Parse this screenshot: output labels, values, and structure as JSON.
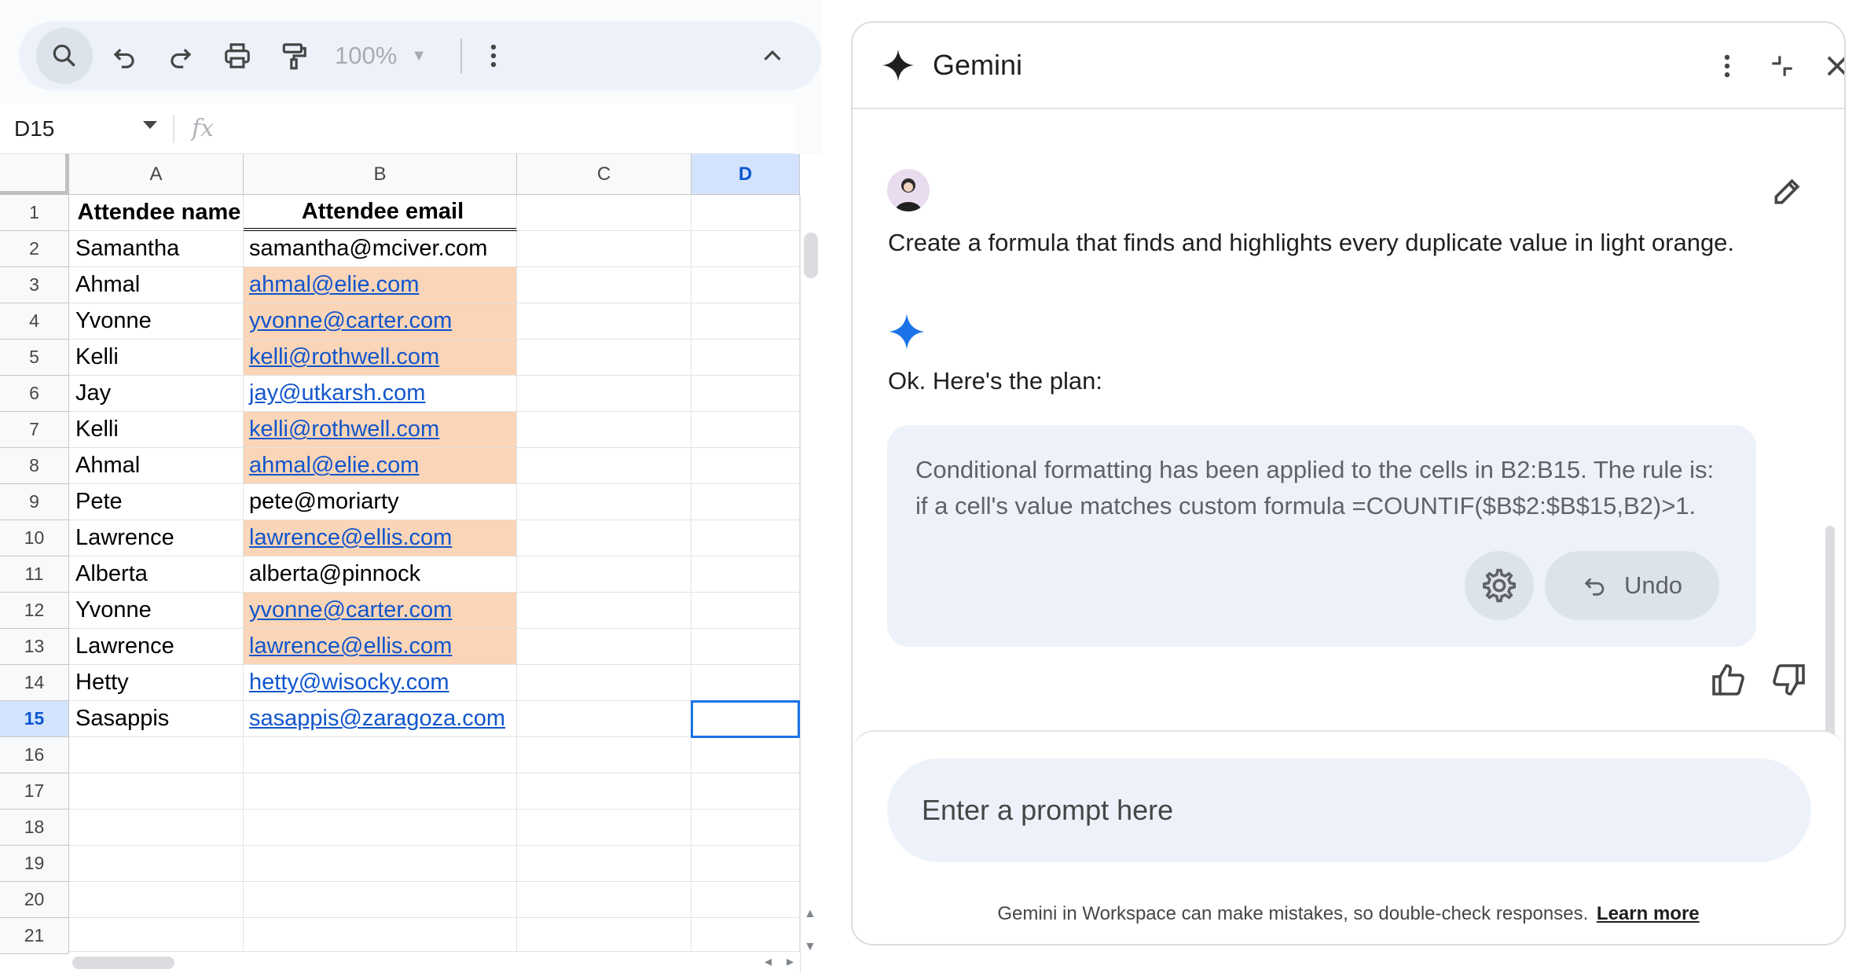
{
  "toolbar": {
    "zoom": "100%"
  },
  "formula_bar": {
    "cell_ref": "D15",
    "fx_label": "fx"
  },
  "sheet": {
    "columns": [
      "A",
      "B",
      "C",
      "D"
    ],
    "selected_column": "D",
    "selected_row": 15,
    "row_numbers": [
      "1",
      "2",
      "3",
      "4",
      "5",
      "6",
      "7",
      "8",
      "9",
      "10",
      "11",
      "12",
      "13",
      "14",
      "15",
      "16",
      "17",
      "18",
      "19",
      "20",
      "21"
    ],
    "rows": [
      {
        "name": "Attendee name",
        "email": "Attendee email",
        "header": true
      },
      {
        "name": "Samantha",
        "email": "samantha@mciver.com",
        "dup": false,
        "link": false
      },
      {
        "name": "Ahmal",
        "email": "ahmal@elie.com",
        "dup": true,
        "link": true
      },
      {
        "name": "Yvonne",
        "email": "yvonne@carter.com",
        "dup": true,
        "link": true
      },
      {
        "name": "Kelli",
        "email": "kelli@rothwell.com",
        "dup": true,
        "link": true
      },
      {
        "name": "Jay",
        "email": "jay@utkarsh.com",
        "dup": false,
        "link": true
      },
      {
        "name": "Kelli",
        "email": "kelli@rothwell.com",
        "dup": true,
        "link": true
      },
      {
        "name": "Ahmal",
        "email": "ahmal@elie.com",
        "dup": true,
        "link": true
      },
      {
        "name": "Pete",
        "email": "pete@moriarty",
        "dup": false,
        "link": false
      },
      {
        "name": "Lawrence",
        "email": "lawrence@ellis.com",
        "dup": true,
        "link": true
      },
      {
        "name": "Alberta",
        "email": "alberta@pinnock",
        "dup": false,
        "link": false
      },
      {
        "name": "Yvonne",
        "email": "yvonne@carter.com",
        "dup": true,
        "link": true
      },
      {
        "name": "Lawrence",
        "email": "lawrence@ellis.com",
        "dup": true,
        "link": true
      },
      {
        "name": "Hetty",
        "email": "hetty@wisocky.com",
        "dup": false,
        "link": true
      },
      {
        "name": "Sasappis",
        "email": "sasappis@zaragoza.com",
        "dup": false,
        "link": true
      }
    ],
    "highlight_color": "#fbd5b7"
  },
  "gemini": {
    "title": "Gemini",
    "user_message": "Create a formula that finds and highlights every duplicate value in light orange.",
    "reply_intro": "Ok. Here's the plan:",
    "result_line1": "Conditional formatting has been applied to the cells in B2:B15. The rule is:",
    "result_line2": "if a cell's value matches custom formula =COUNTIF($B$2:$B$15,B2)>1.",
    "undo_label": "Undo",
    "prompt_placeholder": "Enter a prompt here",
    "disclaimer": "Gemini in Workspace can make mistakes, so double-check responses.",
    "learn_more": "Learn more",
    "brand_color": "#1a73e8"
  }
}
